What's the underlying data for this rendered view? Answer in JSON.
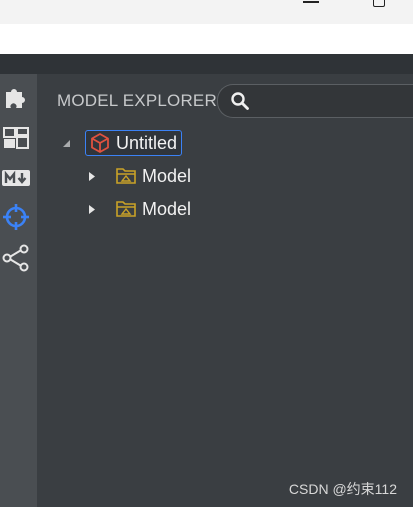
{
  "panel": {
    "title": "MODEL EXPLORER"
  },
  "search": {
    "placeholder": ""
  },
  "tree": {
    "root": {
      "label": "Untitled",
      "expanded": true
    },
    "children": [
      {
        "label": "Model",
        "expanded": false
      },
      {
        "label": "Model",
        "expanded": false
      }
    ]
  },
  "sidebar": {
    "items": [
      {
        "icon": "puzzle-icon"
      },
      {
        "icon": "layout-icon"
      },
      {
        "icon": "markdown-icon"
      },
      {
        "icon": "crosshair-icon",
        "active": true
      },
      {
        "icon": "share-icon"
      }
    ]
  },
  "watermark": "CSDN @约束112",
  "colors": {
    "accent": "#3b82f6",
    "folder": "#c9a227",
    "cube": "#e0523f",
    "sidebar_bg": "#4a4e52",
    "panel_bg": "#3a3e42"
  }
}
